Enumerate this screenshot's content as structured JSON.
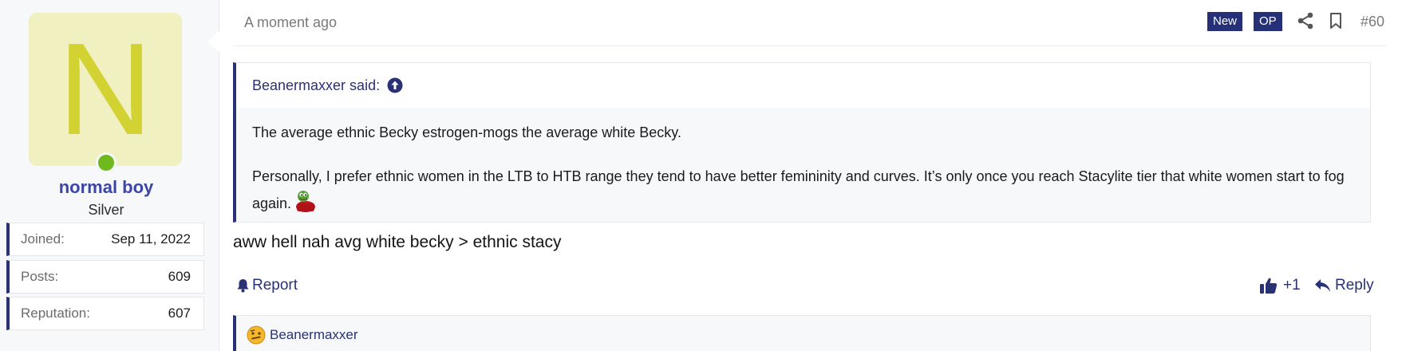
{
  "user": {
    "avatar_letter": "N",
    "avatar_bg": "#f0f0c0",
    "avatar_fg": "#d2d233",
    "online_color": "#6fb91c",
    "name": "normal boy",
    "title": "Silver",
    "stats": [
      {
        "label": "Joined:",
        "value": "Sep 11, 2022"
      },
      {
        "label": "Posts:",
        "value": "609"
      },
      {
        "label": "Reputation:",
        "value": "607"
      }
    ]
  },
  "post": {
    "time": "A moment ago",
    "badges": {
      "new": "New",
      "op": "OP"
    },
    "icons": [
      "share-icon",
      "bookmark-icon"
    ],
    "number": "#60",
    "quote": {
      "author_line": "Beanermaxxer said:",
      "paragraphs": [
        "The average ethnic Becky estrogen-mogs the average white Becky.",
        "Personally, I prefer ethnic women in the LTB to HTB range they tend to have better femininity and curves. It’s only once you reach Stacylite tier that white women start to fog again."
      ]
    },
    "body": "aww hell nah avg white becky > ethnic stacy",
    "actions": {
      "report": "Report",
      "like_count": "+1",
      "reply": "Reply"
    },
    "reaction_user": "Beanermaxxer"
  },
  "colors": {
    "accent": "#2a3275",
    "badge_bg": "#253076",
    "username": "#3b45a8"
  }
}
